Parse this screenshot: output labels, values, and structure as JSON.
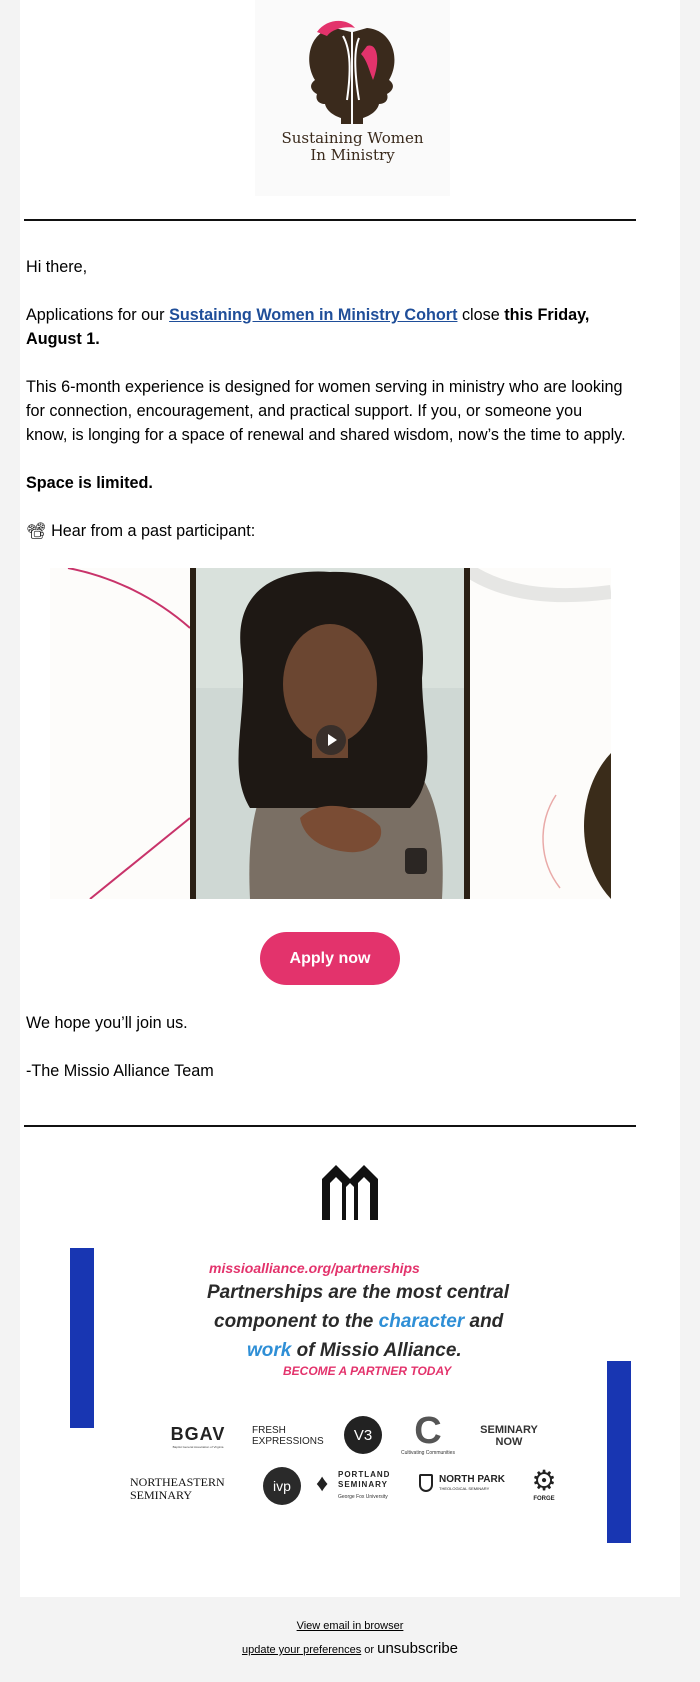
{
  "header": {
    "logo_line1": "Sustaining Women",
    "logo_line2": "In Ministry"
  },
  "body": {
    "greeting": "Hi there,",
    "p1_prefix": "Applications for our ",
    "p1_link": "Sustaining Women in Ministry Cohort",
    "p1_mid": " close ",
    "p1_bold": "this Friday, August 1.",
    "p2": "This 6-month experience is designed for women serving in ministry who are looking for connection, encouragement, and practical support. If you, or someone you know, is longing for a space of renewal and shared wisdom, now’s the time to apply.",
    "space_limited": "Space is limited.",
    "hear_emoji": "📽",
    "hear_text": "Hear from a past participant:",
    "apply_label": "Apply now",
    "closing": "We hope you’ll join us.",
    "signature": "-The Missio Alliance Team"
  },
  "partners": {
    "url": "missioalliance.org/partnerships",
    "line1": "Partnerships are the most central",
    "line2a": "component to the ",
    "line2b": "character",
    "line2c": " and",
    "line3a": "work",
    "line3b": " of Missio Alliance.",
    "cta": "BECOME A PARTNER TODAY",
    "logos_row1": [
      "BGAV",
      "FRESH EXPRESSIONS",
      "V3",
      "Cultivating Communities",
      "SEMINARY NOW"
    ],
    "bgav_sub": "Baptist General Association of Virginia",
    "logos_row2": [
      "NORTHEASTERN SEMINARY",
      "ivp",
      "PORTLAND SEMINARY",
      "NORTH PARK",
      "FORGE"
    ],
    "portland_sub": "George Fox University",
    "northpark_sub": "THEOLOGICAL SEMINARY",
    "colors": {
      "pink": "#e3336c",
      "blue": "#1836b2",
      "text_blue": "#2f8fd6",
      "dark": "#2a2a2a"
    }
  },
  "footer": {
    "view_browser": "View email in browser",
    "update_prefs": "update your preferences",
    "or": " or ",
    "unsubscribe": "unsubscribe"
  }
}
